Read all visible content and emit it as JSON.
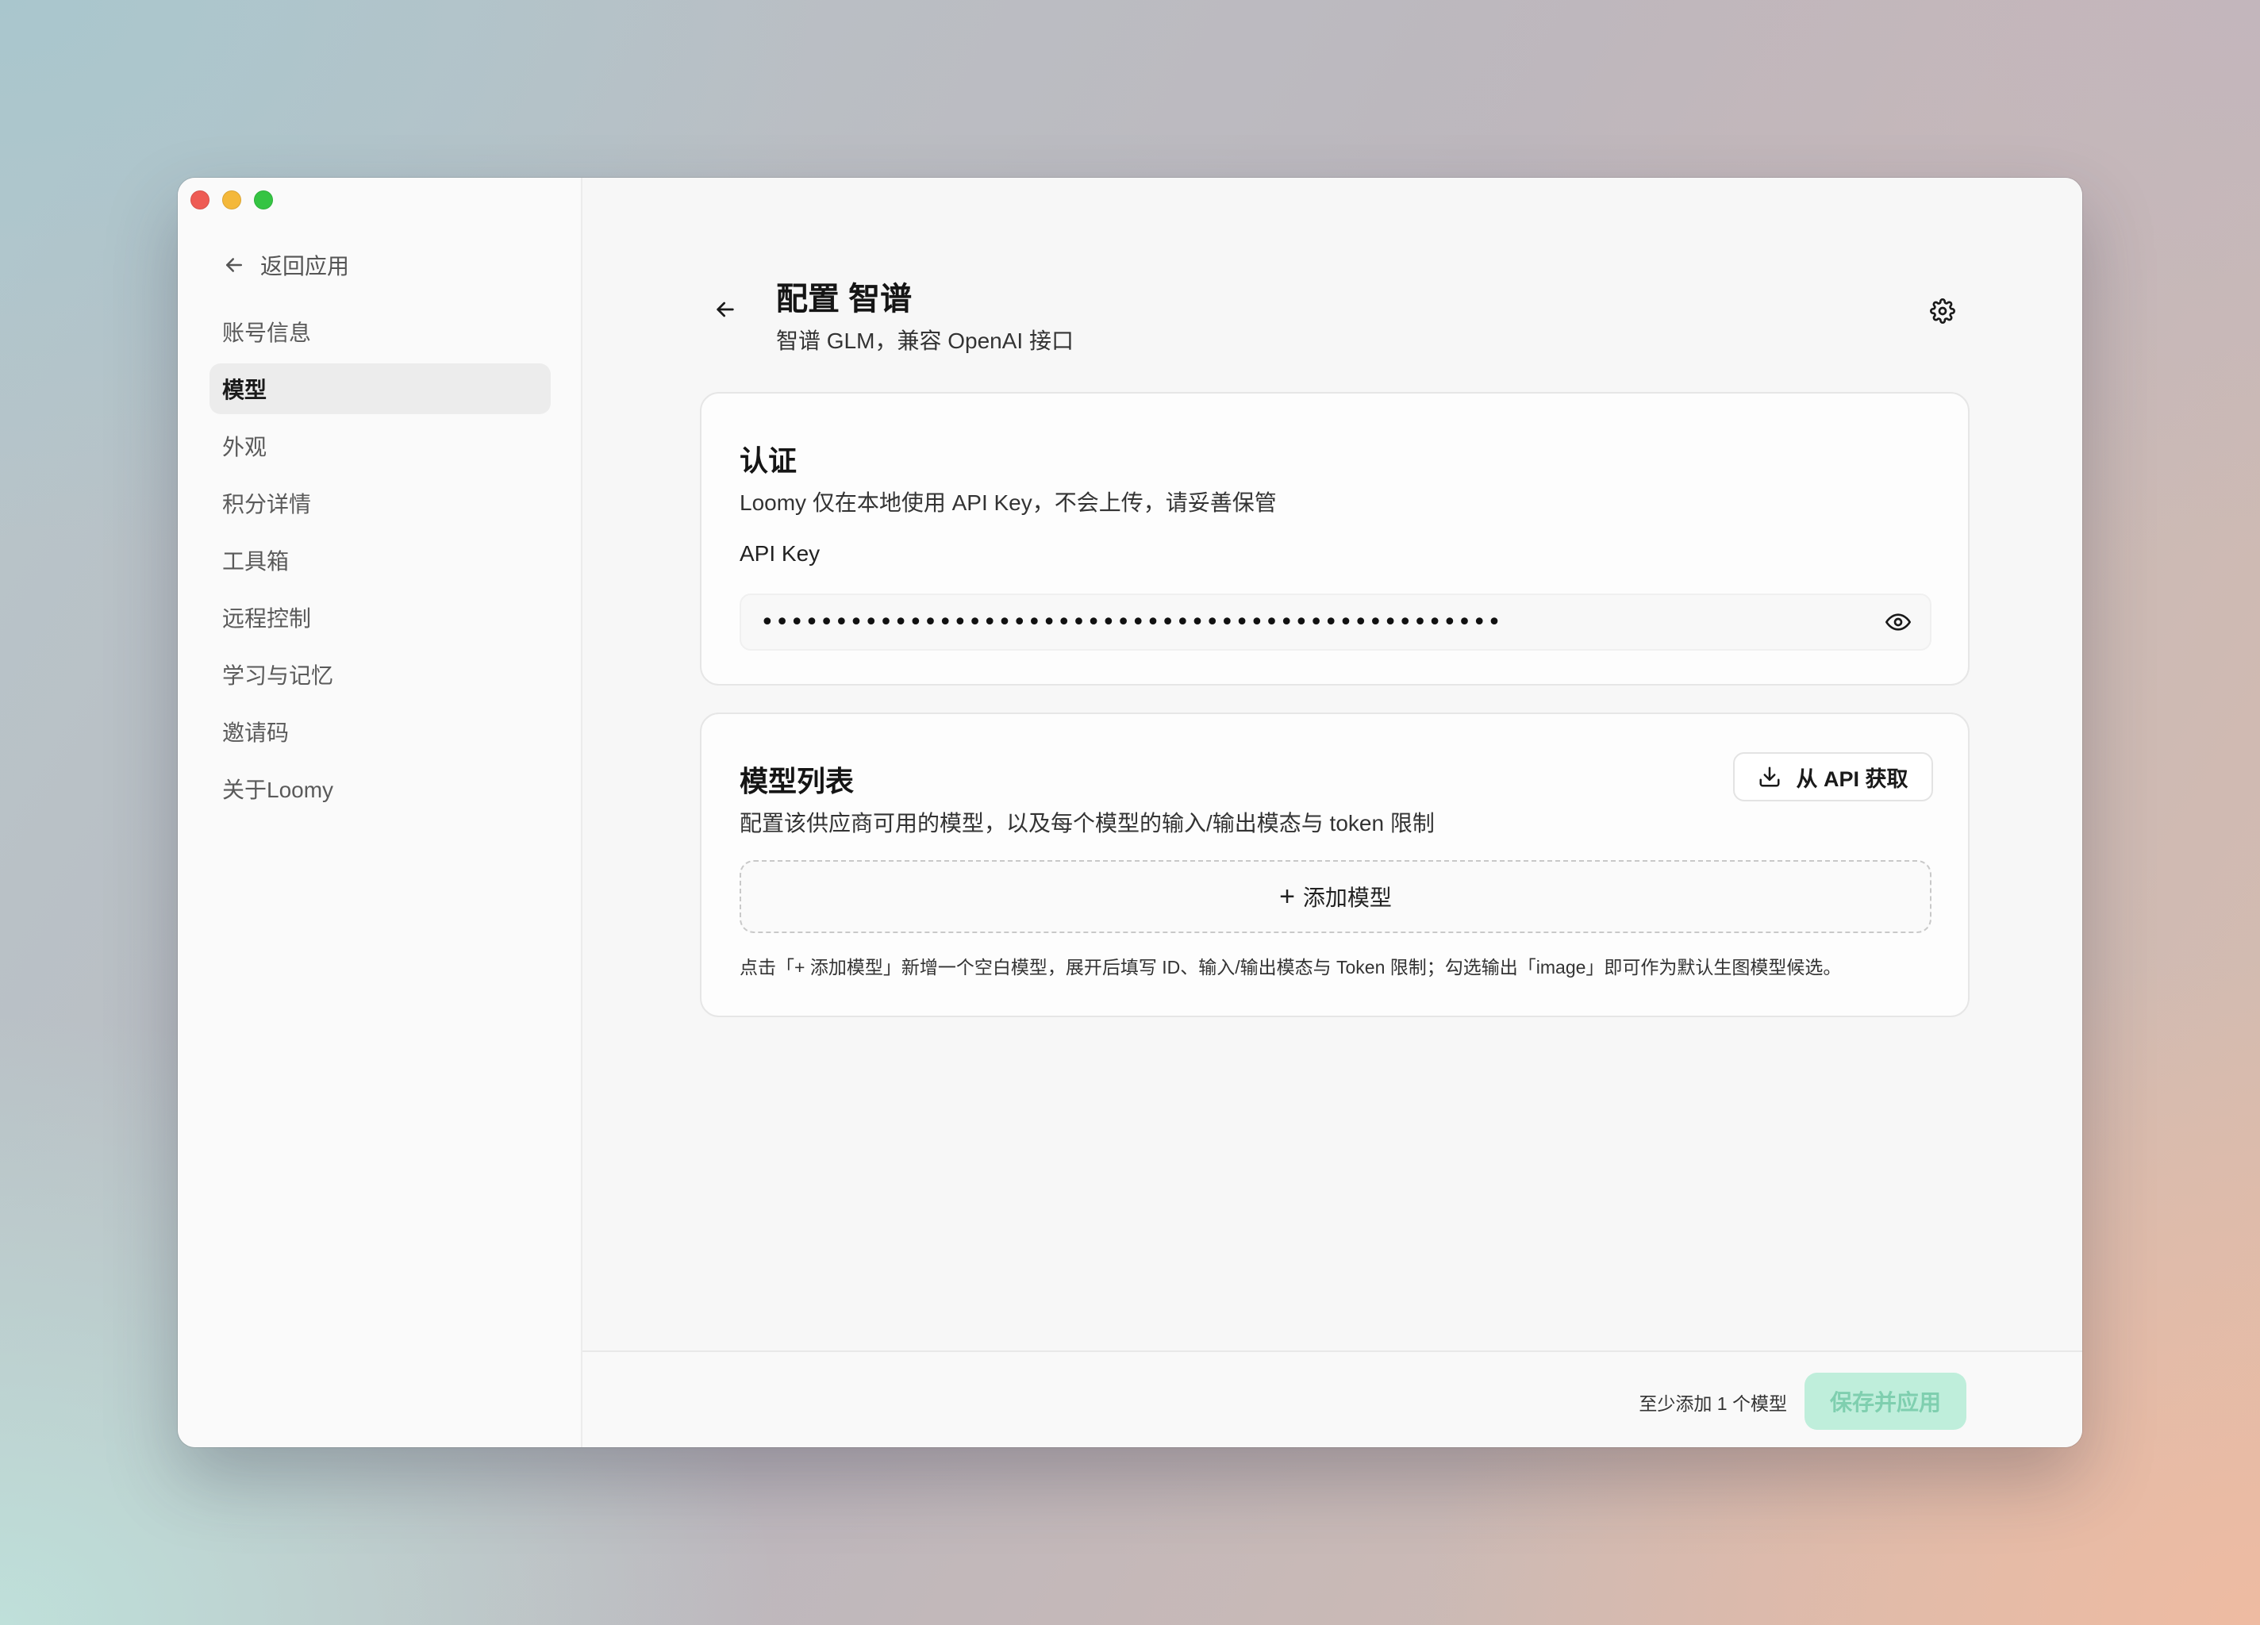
{
  "sidebar": {
    "back_label": "返回应用",
    "items": [
      {
        "label": "账号信息",
        "active": false
      },
      {
        "label": "模型",
        "active": true
      },
      {
        "label": "外观",
        "active": false
      },
      {
        "label": "积分详情",
        "active": false
      },
      {
        "label": "工具箱",
        "active": false
      },
      {
        "label": "远程控制",
        "active": false
      },
      {
        "label": "学习与记忆",
        "active": false
      },
      {
        "label": "邀请码",
        "active": false
      },
      {
        "label": "关于Loomy",
        "active": false
      }
    ]
  },
  "header": {
    "title": "配置 智谱",
    "subtitle": "智谱 GLM，兼容 OpenAI 接口"
  },
  "auth": {
    "title": "认证",
    "description": "Loomy 仅在本地使用 API Key，不会上传，请妥善保管",
    "field_label": "API Key",
    "masked_value": "••••••••••••••••••••••••••••••••••••••••••••••••••"
  },
  "models": {
    "title": "模型列表",
    "description": "配置该供应商可用的模型，以及每个模型的输入/输出模态与 token 限制",
    "fetch_button": "从 API 获取",
    "add_plus": "+",
    "add_button": "添加模型",
    "hint": "点击「+ 添加模型」新增一个空白模型，展开后填写 ID、输入/输出模态与 Token 限制；勾选输出「image」即可作为默认生图模型候选。"
  },
  "footer": {
    "hint": "至少添加 1 个模型",
    "save_button": "保存并应用"
  },
  "colors": {
    "accent_disabled_bg": "#bfeedb",
    "accent_disabled_text": "#7fcfaf",
    "traffic_red": "#ee5b54",
    "traffic_yellow": "#f4b83a",
    "traffic_green": "#35c443"
  },
  "icons": {
    "back": "arrow-left-icon",
    "settings": "gear-icon",
    "reveal": "eye-icon",
    "fetch": "download-icon"
  }
}
